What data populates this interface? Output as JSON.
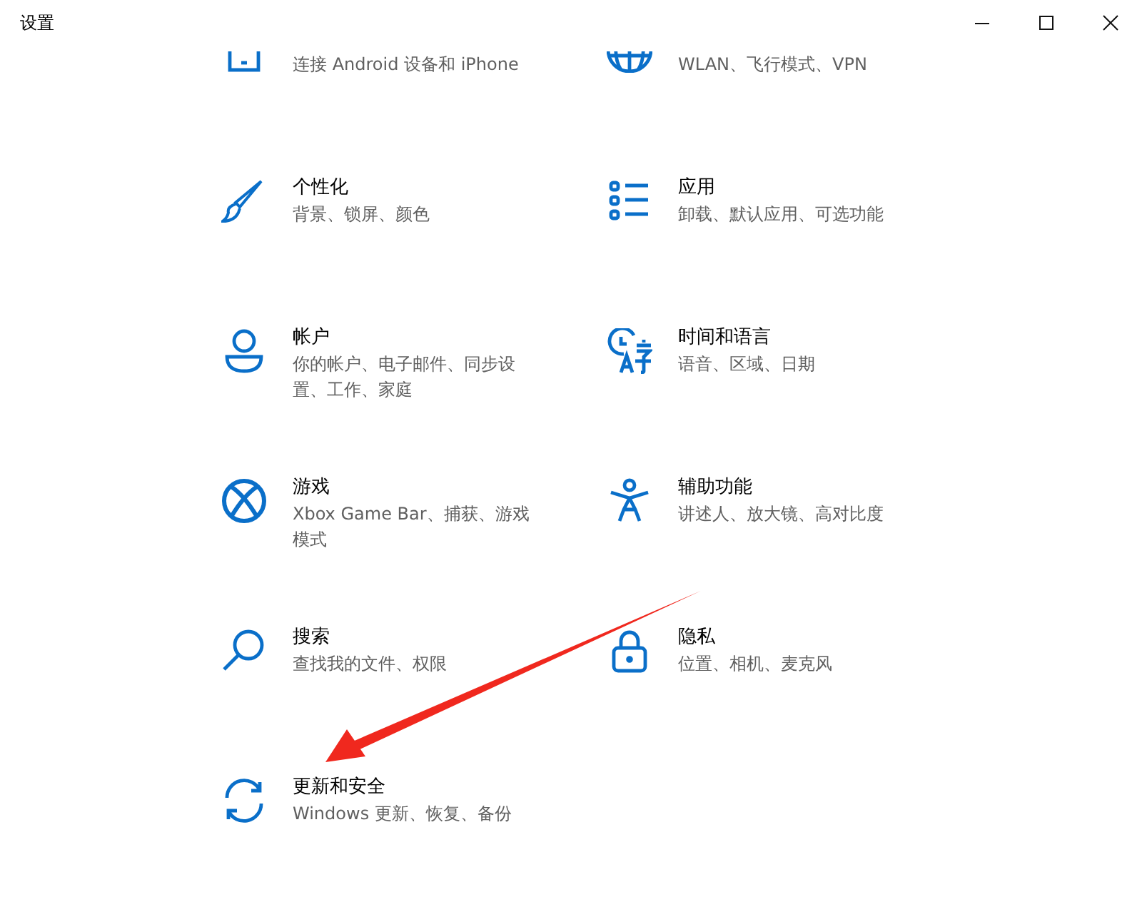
{
  "window": {
    "title": "设置",
    "controls": [
      {
        "kind": "minimize"
      },
      {
        "kind": "maximize"
      },
      {
        "kind": "close"
      }
    ]
  },
  "tiles": [
    {
      "kind": "phone",
      "subtitle": "连接 Android 设备和 iPhone"
    },
    {
      "kind": "globe",
      "subtitle": "WLAN、飞行模式、VPN"
    },
    {
      "kind": "brush",
      "title": "个性化",
      "subtitle": "背景、锁屏、颜色"
    },
    {
      "kind": "apps",
      "title": "应用",
      "subtitle": "卸载、默认应用、可选功能"
    },
    {
      "kind": "person",
      "title": "帐户",
      "subtitle": "你的帐户、电子邮件、同步设置、工作、家庭"
    },
    {
      "kind": "language",
      "title": "时间和语言",
      "subtitle": "语音、区域、日期"
    },
    {
      "kind": "xbox",
      "title": "游戏",
      "subtitle": "Xbox Game Bar、捕获、游戏模式"
    },
    {
      "kind": "accessibility",
      "title": "辅助功能",
      "subtitle": "讲述人、放大镜、高对比度"
    },
    {
      "kind": "search",
      "title": "搜索",
      "subtitle": "查找我的文件、权限"
    },
    {
      "kind": "lock",
      "title": "隐私",
      "subtitle": "位置、相机、麦克风"
    },
    {
      "kind": "sync",
      "title": "更新和安全",
      "subtitle": "Windows 更新、恢复、备份"
    }
  ],
  "overlay": {
    "kind": "arrow"
  }
}
